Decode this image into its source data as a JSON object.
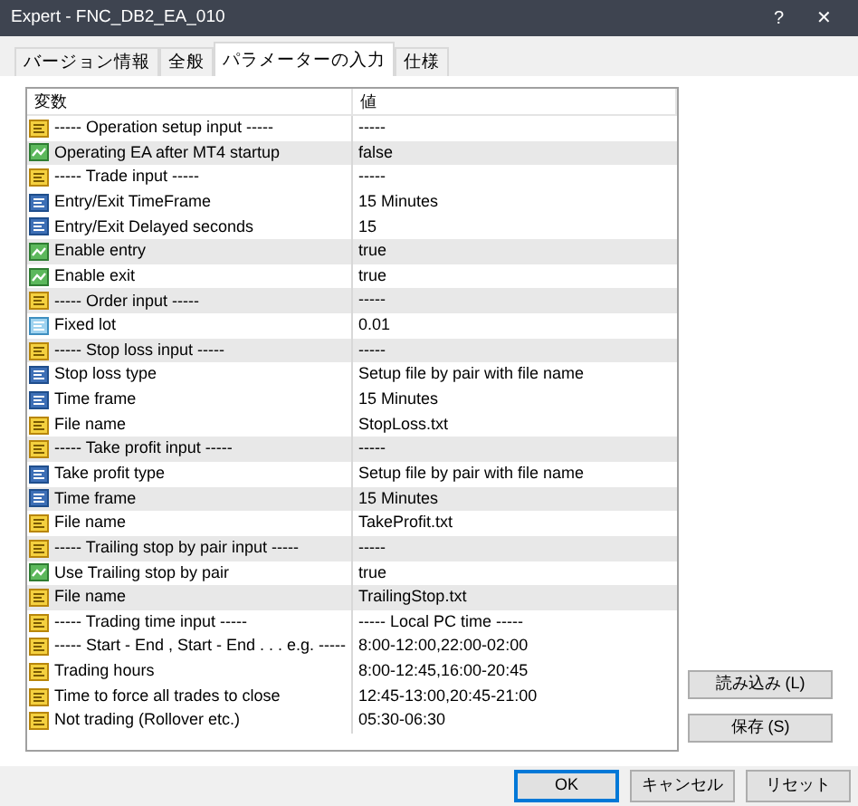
{
  "window": {
    "title": "Expert - FNC_DB2_EA_010",
    "help": "?",
    "close": "✕"
  },
  "tabs": [
    {
      "label": "バージョン情報",
      "selected": false
    },
    {
      "label": "全般",
      "selected": false
    },
    {
      "label": "パラメーターの入力",
      "selected": true
    },
    {
      "label": "仕様",
      "selected": false
    }
  ],
  "table": {
    "columns": [
      "変数",
      "値"
    ],
    "rows": [
      {
        "kind": "string",
        "name": "----- Operation setup input -----",
        "value": "-----",
        "shaded": false
      },
      {
        "kind": "bool",
        "name": "Operating EA after MT4 startup",
        "value": "false",
        "shaded": true
      },
      {
        "kind": "string",
        "name": "----- Trade input -----",
        "value": "-----",
        "shaded": false
      },
      {
        "kind": "enum",
        "name": "Entry/Exit TimeFrame",
        "value": "15 Minutes",
        "shaded": false
      },
      {
        "kind": "enum",
        "name": "Entry/Exit Delayed seconds",
        "value": "15",
        "shaded": false
      },
      {
        "kind": "bool",
        "name": "Enable entry",
        "value": "true",
        "shaded": true
      },
      {
        "kind": "bool",
        "name": "Enable exit",
        "value": "true",
        "shaded": false
      },
      {
        "kind": "string",
        "name": "----- Order input -----",
        "value": "-----",
        "shaded": true
      },
      {
        "kind": "double",
        "name": "Fixed lot",
        "value": "0.01",
        "shaded": false
      },
      {
        "kind": "string",
        "name": "----- Stop loss input -----",
        "value": "-----",
        "shaded": true
      },
      {
        "kind": "enum",
        "name": "Stop loss type",
        "value": "Setup file by pair with file name",
        "shaded": false
      },
      {
        "kind": "enum",
        "name": "Time frame",
        "value": "15 Minutes",
        "shaded": false
      },
      {
        "kind": "string",
        "name": "File name",
        "value": "StopLoss.txt",
        "shaded": false
      },
      {
        "kind": "string",
        "name": "----- Take profit input -----",
        "value": "-----",
        "shaded": true
      },
      {
        "kind": "enum",
        "name": "Take profit type",
        "value": "Setup file by pair with file name",
        "shaded": false
      },
      {
        "kind": "enum",
        "name": "Time frame",
        "value": "15 Minutes",
        "shaded": true
      },
      {
        "kind": "string",
        "name": "File name",
        "value": "TakeProfit.txt",
        "shaded": false
      },
      {
        "kind": "string",
        "name": "----- Trailing stop by pair input -----",
        "value": "-----",
        "shaded": true
      },
      {
        "kind": "bool",
        "name": "Use Trailing stop by pair",
        "value": "true",
        "shaded": false
      },
      {
        "kind": "string",
        "name": "File name",
        "value": "TrailingStop.txt",
        "shaded": true
      },
      {
        "kind": "string",
        "name": "----- Trading time input -----",
        "value": "----- Local PC time -----",
        "shaded": false
      },
      {
        "kind": "string",
        "name": "----- Start - End , Start - End . . . e.g. -----",
        "value": "8:00-12:00,22:00-02:00",
        "shaded": false
      },
      {
        "kind": "string",
        "name": "Trading hours",
        "value": "8:00-12:45,16:00-20:45",
        "shaded": false
      },
      {
        "kind": "string",
        "name": "Time to force all trades to close",
        "value": "12:45-13:00,20:45-21:00",
        "shaded": false
      },
      {
        "kind": "string",
        "name": "Not trading (Rollover etc.)",
        "value": "05:30-06:30",
        "shaded": false
      }
    ]
  },
  "side_buttons": [
    "読み込み (L)",
    "保存 (S)"
  ],
  "buttons": [
    {
      "label": "OK",
      "default": true
    },
    {
      "label": "キャンセル",
      "default": false
    },
    {
      "label": "リセット",
      "default": false
    }
  ]
}
